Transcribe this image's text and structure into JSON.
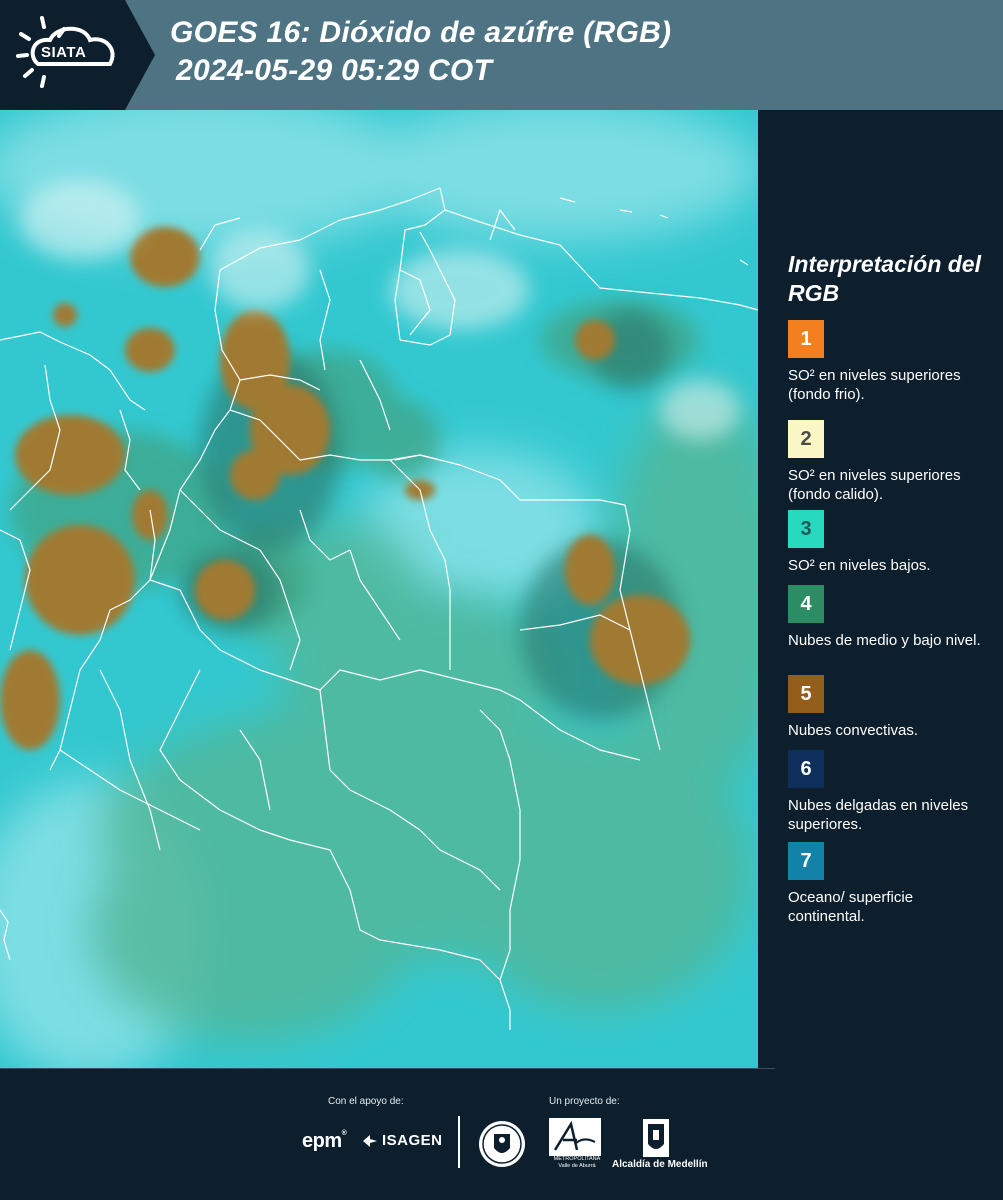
{
  "header": {
    "logo_text": "SIATA",
    "title_line1": "GOES 16: Dióxido de azúfre (RGB)",
    "title_line2": "2024-05-29 05:29 COT"
  },
  "legend": {
    "title": "Interpretación del RGB",
    "items": [
      {
        "number": "1",
        "label": "SO² en niveles superiores (fondo frio).",
        "color": "#f47f1f",
        "text_color": "#ffffff"
      },
      {
        "number": "2",
        "label": "SO² en niveles superiores (fondo calido).",
        "color": "#fbf6c6",
        "text_color": "#4a4a4a"
      },
      {
        "number": "3",
        "label": "SO² en niveles bajos.",
        "color": "#27d9bd",
        "text_color": "#1d5a5a"
      },
      {
        "number": "4",
        "label": "Nubes de medio y bajo nivel.",
        "color": "#2c8c63",
        "text_color": "#ffffff"
      },
      {
        "number": "5",
        "label": "Nubes convectivas.",
        "color": "#935e1b",
        "text_color": "#ffffff"
      },
      {
        "number": "6",
        "label": "Nubes delgadas en niveles superiores.",
        "color": "#0e2f5c",
        "text_color": "#ffffff"
      },
      {
        "number": "7",
        "label": "Oceano/ superficie continental.",
        "color": "#1282a8",
        "text_color": "#ffffff"
      }
    ]
  },
  "footer": {
    "support_label": "Con el apoyo de:",
    "project_label": "Un proyecto de:",
    "epm": "epm",
    "isagen": "ISAGEN",
    "area_text": "METROPOLITANA Valle de Aburrá",
    "alcaldia": "Alcaldía de Medellín"
  }
}
